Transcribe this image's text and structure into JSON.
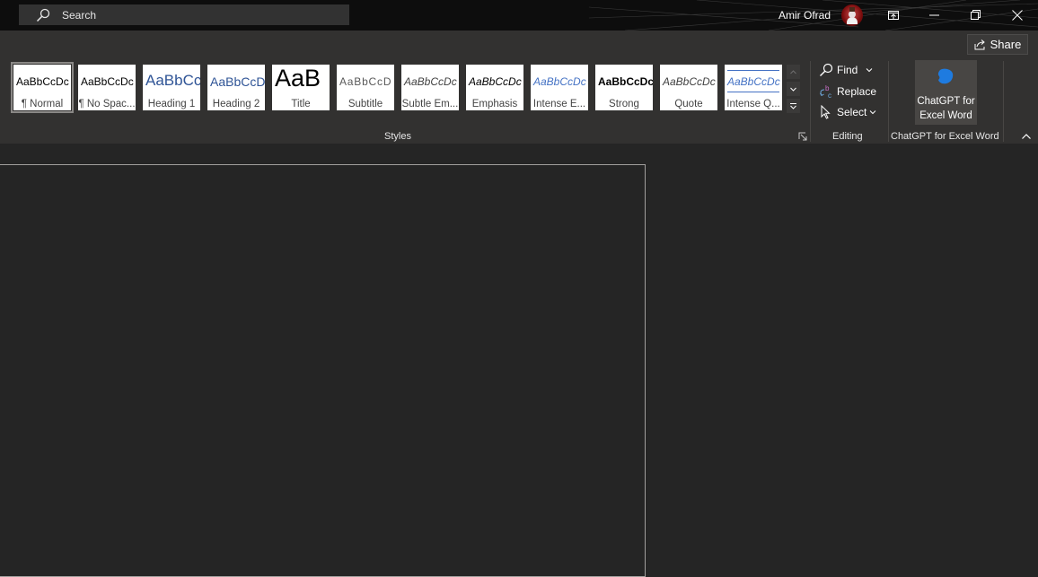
{
  "titlebar": {
    "search_label": "Search",
    "user_name": "Amir Ofrad",
    "icons": {
      "search": "search-icon",
      "avatar": "user-avatar",
      "ribbon_display": "ribbon-display-options-icon",
      "minimize": "minimize-icon",
      "restore": "restore-icon",
      "close": "close-icon"
    }
  },
  "ribbon": {
    "share_label": "Share",
    "styles": {
      "group_label": "Styles",
      "items": [
        {
          "sample": "AaBbCcDc",
          "name": "¶ Normal",
          "selected": true
        },
        {
          "sample": "AaBbCcDc",
          "name": "¶ No Spac..."
        },
        {
          "sample": "AaBbCc",
          "name": "Heading 1"
        },
        {
          "sample": "AaBbCcD",
          "name": "Heading 2"
        },
        {
          "sample": "AaB",
          "name": "Title"
        },
        {
          "sample": "AaBbCcD",
          "name": "Subtitle"
        },
        {
          "sample": "AaBbCcDc",
          "name": "Subtle Em..."
        },
        {
          "sample": "AaBbCcDc",
          "name": "Emphasis"
        },
        {
          "sample": "AaBbCcDc",
          "name": "Intense E..."
        },
        {
          "sample": "AaBbCcDc",
          "name": "Strong"
        },
        {
          "sample": "AaBbCcDc",
          "name": "Quote"
        },
        {
          "sample": "AaBbCcDc",
          "name": "Intense Q..."
        }
      ]
    },
    "editing": {
      "group_label": "Editing",
      "find_label": "Find",
      "replace_label": "Replace",
      "select_label": "Select"
    },
    "chatgpt": {
      "group_label": "ChatGPT for Excel Word",
      "button_line1": "ChatGPT for",
      "button_line2": "Excel Word",
      "accent": "#1e7be0"
    }
  },
  "colors": {
    "titlebar_bg": "#0d0d0d",
    "ribbon_bg": "#323130",
    "document_bg": "#252525",
    "heading_blue": "#2f5496",
    "accent_blue": "#4472c4"
  }
}
